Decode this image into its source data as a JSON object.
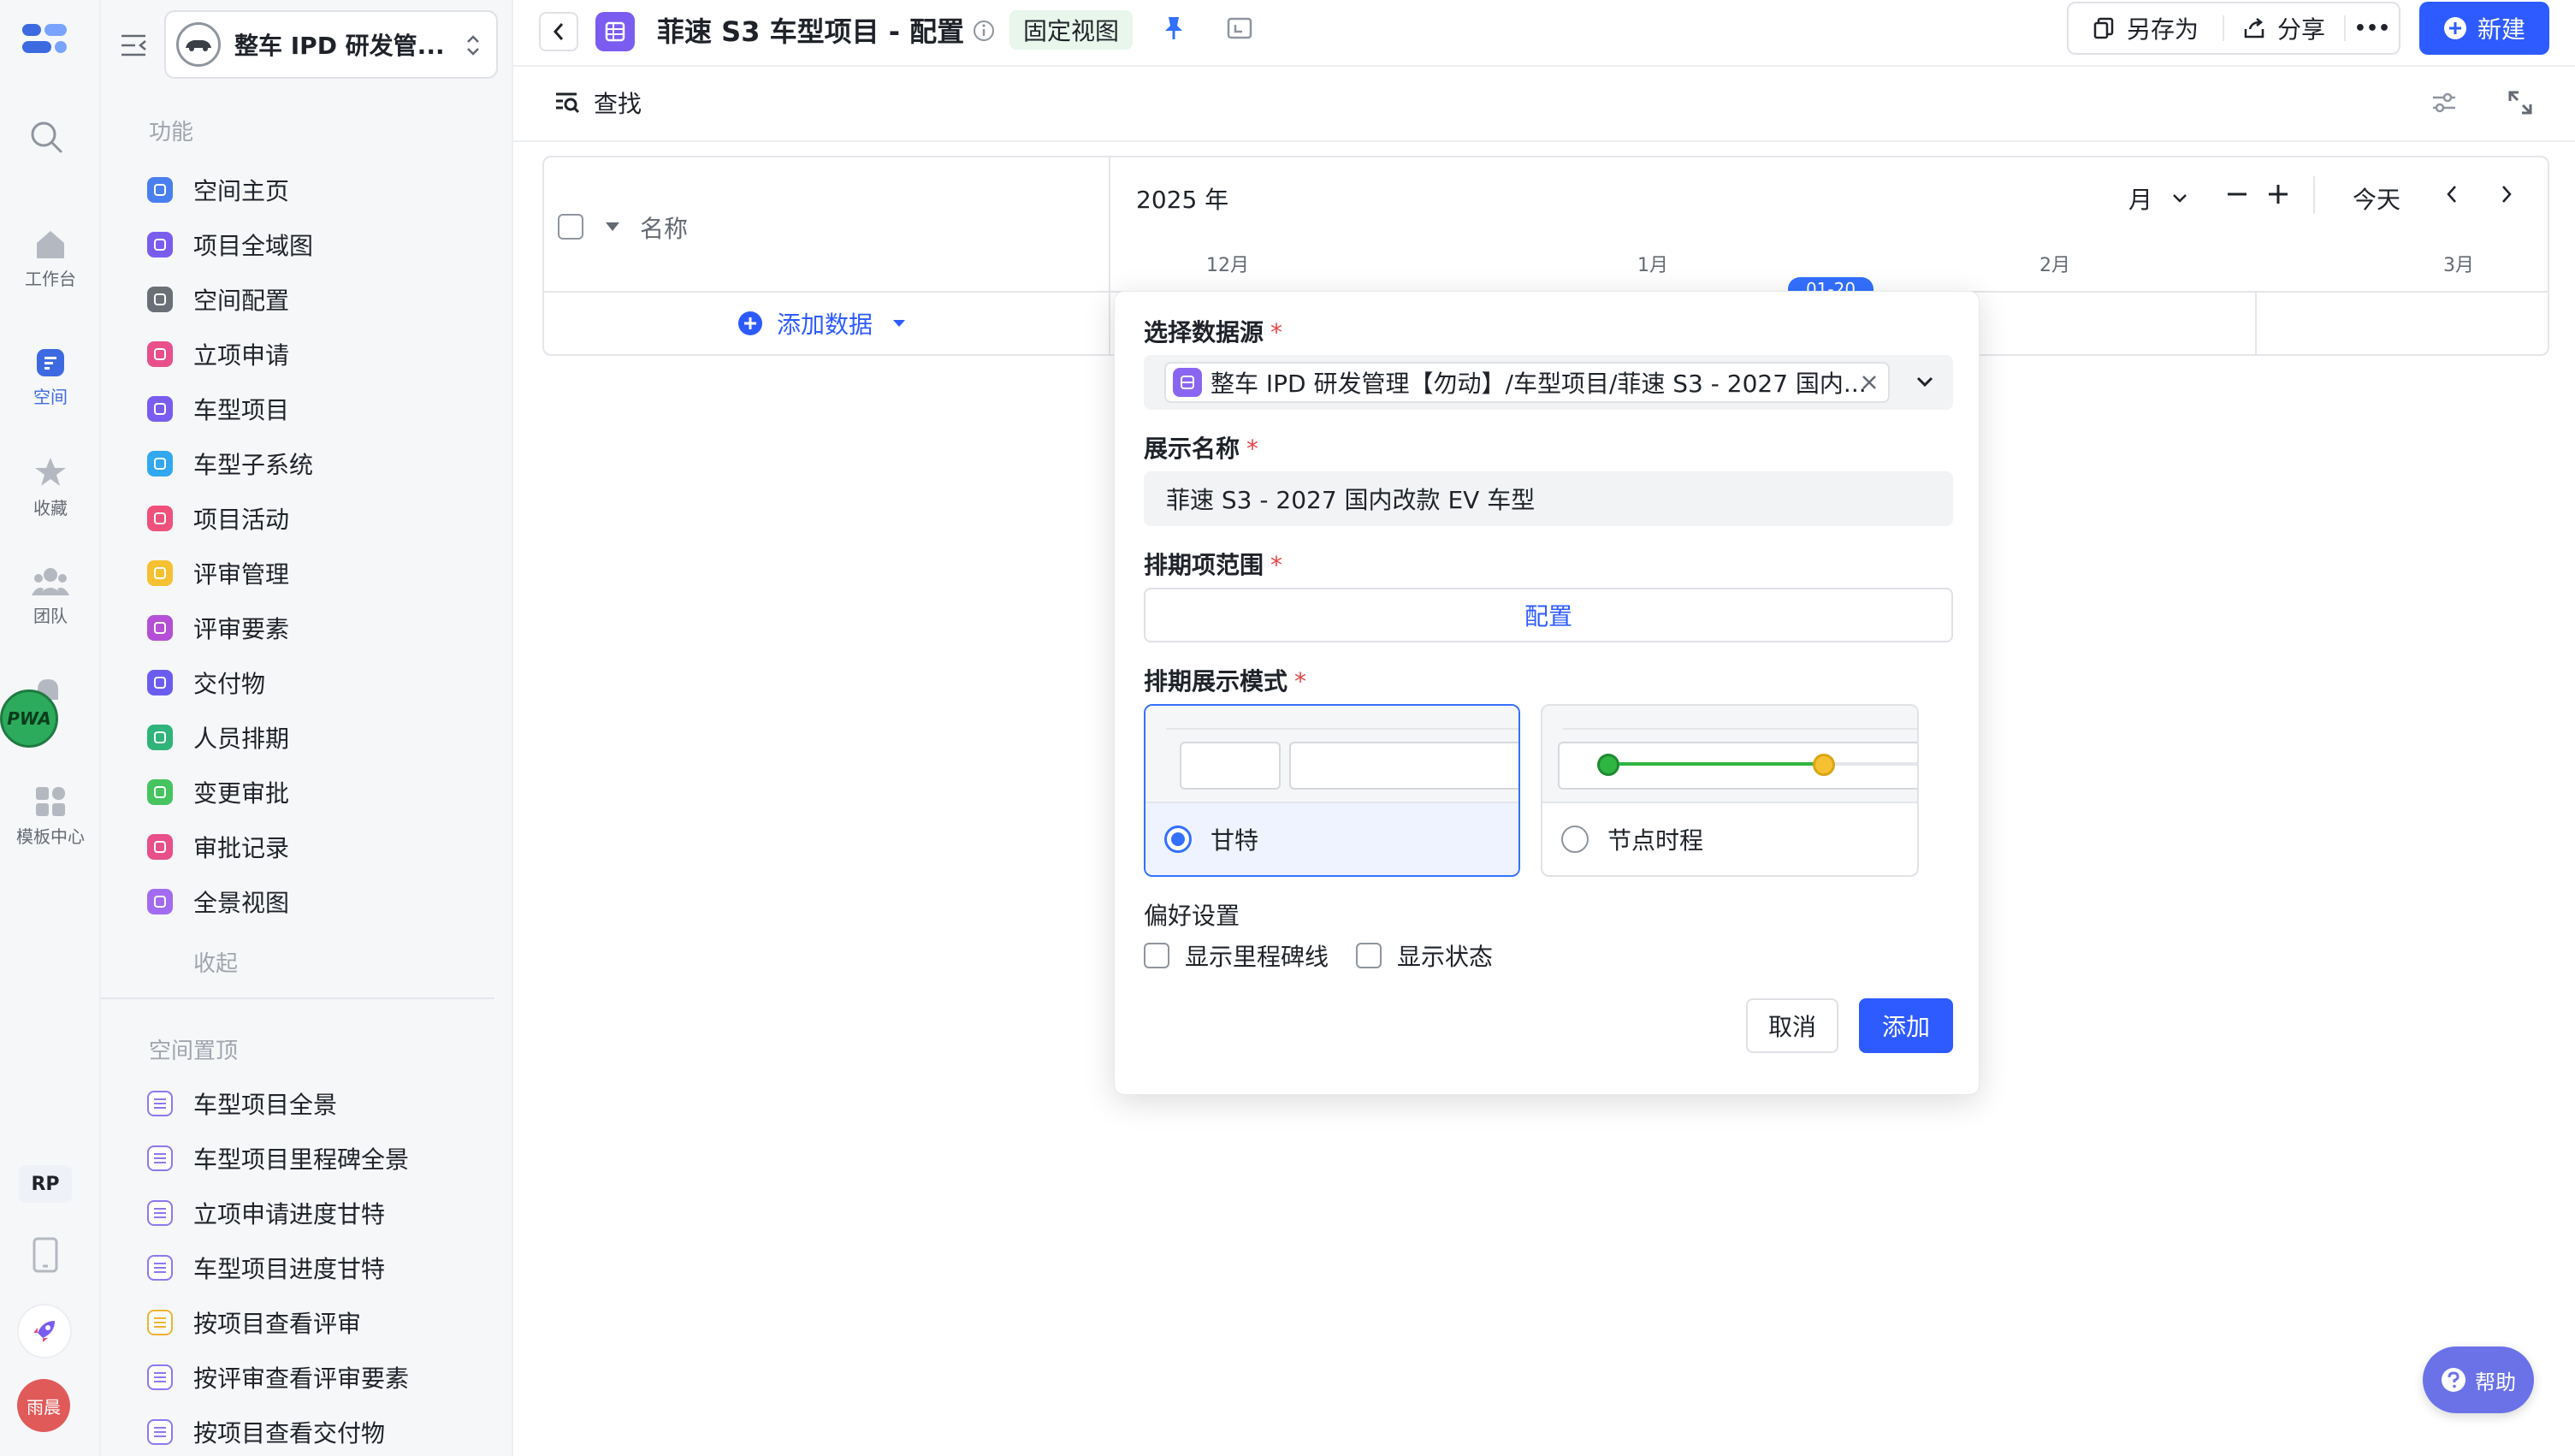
{
  "rail": {
    "items": [
      {
        "label": "工作台",
        "icon": "home-icon"
      },
      {
        "label": "空间",
        "icon": "space-icon"
      },
      {
        "label": "收藏",
        "icon": "star-icon"
      },
      {
        "label": "团队",
        "icon": "team-icon"
      },
      {
        "label": "模板中心",
        "icon": "template-icon"
      }
    ],
    "pwa_badge": "PWA",
    "rp_badge": "RP",
    "avatar_text": "雨晨"
  },
  "sidebar": {
    "workspace_name": "整车 IPD 研发管...",
    "section_functions": "功能",
    "functions": [
      {
        "label": "空间主页",
        "color": "#4a7ff0"
      },
      {
        "label": "项目全域图",
        "color": "#7b5cf0"
      },
      {
        "label": "空间配置",
        "color": "#6b6f76"
      },
      {
        "label": "立项申请",
        "color": "#e84f8b"
      },
      {
        "label": "车型项目",
        "color": "#7b5cf0"
      },
      {
        "label": "车型子系统",
        "color": "#32a8f0"
      },
      {
        "label": "项目活动",
        "color": "#f0507c"
      },
      {
        "label": "评审管理",
        "color": "#f5c132"
      },
      {
        "label": "评审要素",
        "color": "#b44fd6"
      },
      {
        "label": "交付物",
        "color": "#6b5cf0"
      },
      {
        "label": "人员排期",
        "color": "#2fb57a"
      },
      {
        "label": "变更审批",
        "color": "#45c460"
      },
      {
        "label": "审批记录",
        "color": "#e84f8b"
      },
      {
        "label": "全景视图",
        "color": "#a36cf0"
      }
    ],
    "collapse_label": "收起",
    "section_pinned": "空间置顶",
    "pinned": [
      {
        "label": "车型项目全景",
        "color": "#8d78f0"
      },
      {
        "label": "车型项目里程碑全景",
        "color": "#8d78f0"
      },
      {
        "label": "立项申请进度甘特",
        "color": "#8d78f0"
      },
      {
        "label": "车型项目进度甘特",
        "color": "#8d78f0"
      },
      {
        "label": "按项目查看评审",
        "color": "#f0b132"
      },
      {
        "label": "按评审查看评审要素",
        "color": "#8d78f0"
      },
      {
        "label": "按项目查看交付物",
        "color": "#8d78f0"
      }
    ]
  },
  "topbar": {
    "title": "菲速 S3 车型项目 - 配置",
    "fixed_view_badge": "固定视图",
    "save_as_label": "另存为",
    "share_label": "分享",
    "more_label": "•••",
    "new_label": "新建"
  },
  "search": {
    "label": "查找"
  },
  "gantt": {
    "name_header": "名称",
    "add_data_label": "添加数据",
    "year_label": "2025 年",
    "zoom_unit": "月",
    "today_label": "今天",
    "months": [
      "12月",
      "1月",
      "2月",
      "3月"
    ],
    "today_marker": "01-20"
  },
  "dialog": {
    "source_label": "选择数据源",
    "source_value": "整车 IPD 研发管理【勿动】/车型项目/菲速 S3 - 2027 国内...",
    "display_name_label": "展示名称",
    "display_name_value": "菲速 S3 - 2027 国内改款 EV 车型",
    "range_label": "排期项范围",
    "configure_label": "配置",
    "mode_label": "排期展示模式",
    "mode_gantt": "甘特",
    "mode_timeline": "节点时程",
    "prefs_label": "偏好设置",
    "show_milestone_label": "显示里程碑线",
    "show_status_label": "显示状态",
    "cancel_label": "取消",
    "add_label": "添加",
    "required_mark": "*"
  },
  "help": {
    "label": "帮助"
  },
  "colors": {
    "primary": "#3370ff",
    "brand_blue": "#2e5bff",
    "accent_green": "#2fb541",
    "accent_yellow": "#f5c132",
    "required_red": "#e54545"
  }
}
